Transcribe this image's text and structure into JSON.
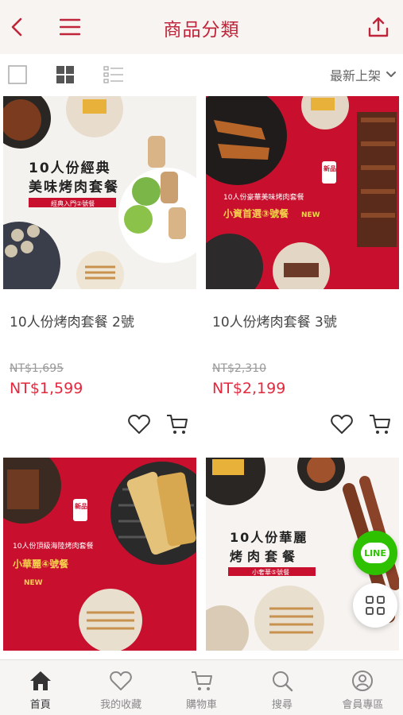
{
  "header": {
    "title": "商品分類",
    "back_icon": "chevron-left-icon",
    "menu_icon": "hamburger-icon",
    "share_icon": "share-icon",
    "accent": "#c0243a"
  },
  "toolbar": {
    "sort_label": "最新上架",
    "view_icons": [
      "single-view-icon",
      "grid-view-icon",
      "list-view-icon"
    ]
  },
  "products": [
    {
      "name": "10人份烤肉套餐  2號",
      "old_price": "NT$1,695",
      "price": "NT$1,599",
      "poster": {
        "line1": "10人份經典",
        "line2": "美味烤肉套餐",
        "tag": "經典入門②號餐"
      }
    },
    {
      "name": "10人份烤肉套餐  3號",
      "old_price": "NT$2,310",
      "price": "NT$2,199",
      "poster": {
        "badge": "新品",
        "line1": "10人份豪華美味烤肉套餐",
        "line2": "小資首選③號餐",
        "tag": "NEW"
      }
    },
    {
      "poster": {
        "badge": "新品",
        "line1": "10人份頂級海陸烤肉套餐",
        "line2": "小華麗④號餐",
        "tag": "NEW"
      }
    },
    {
      "poster": {
        "line1": "10人份華麗",
        "line2": "烤肉套餐",
        "tag": "小奢華⑤號餐"
      }
    }
  ],
  "floating": {
    "line_label": "LINE",
    "grid_icon": "apps-grid-icon"
  },
  "bottom_nav": [
    {
      "label": "首頁",
      "icon": "home-icon"
    },
    {
      "label": "我的收藏",
      "icon": "heart-icon"
    },
    {
      "label": "購物車",
      "icon": "cart-icon"
    },
    {
      "label": "搜尋",
      "icon": "search-icon"
    },
    {
      "label": "會員專區",
      "icon": "user-icon"
    }
  ],
  "colors": {
    "price": "#e4293f",
    "poster_red": "#c8102e",
    "line_green": "#2dc100"
  }
}
